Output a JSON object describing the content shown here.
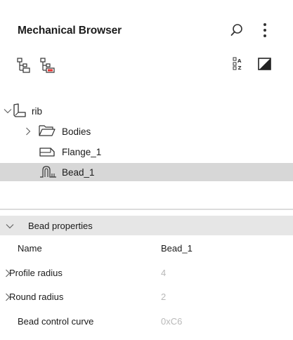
{
  "header": {
    "title": "Mechanical Browser",
    "icons": [
      "search-icon",
      "more-vertical-icon"
    ]
  },
  "toolbar": {
    "icons": [
      "tree-structure-icon",
      "tree-structure-red-icon",
      "sort-az-icon",
      "contrast-icon"
    ],
    "accent_color": "#e8312f"
  },
  "tree": {
    "items": [
      {
        "label": "rib",
        "icon": "part-icon",
        "expanded": true
      },
      {
        "label": "Bodies",
        "icon": "folder-open-icon",
        "expanded": false
      },
      {
        "label": "Flange_1",
        "icon": "flange-icon"
      },
      {
        "label": "Bead_1",
        "icon": "bead-icon",
        "selected": true
      }
    ],
    "selection_color": "#d7d7d7"
  },
  "properties": {
    "header": "Bead properties",
    "rows": [
      {
        "name": "Name",
        "value": "Bead_1",
        "expandable": false
      },
      {
        "name": "Profile radius",
        "value": "4",
        "expandable": true
      },
      {
        "name": "Round radius",
        "value": "2",
        "expandable": true
      },
      {
        "name": "Bead control curve",
        "value": "0xC6",
        "expandable": false
      }
    ]
  }
}
